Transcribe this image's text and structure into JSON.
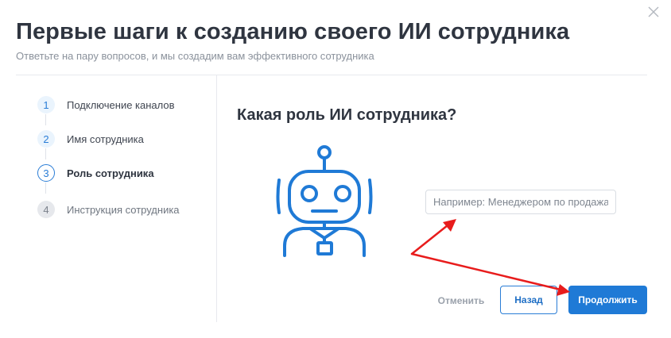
{
  "dialog": {
    "title": "Первые шаги к созданию своего ИИ сотрудника",
    "subtitle": "Ответьте на пару вопросов, и мы создадим вам эффективного сотрудника",
    "close_icon": "close-icon"
  },
  "steps": [
    {
      "num": "1",
      "label": "Подключение каналов",
      "state": "done"
    },
    {
      "num": "2",
      "label": "Имя сотрудника",
      "state": "done"
    },
    {
      "num": "3",
      "label": "Роль сотрудника",
      "state": "active"
    },
    {
      "num": "4",
      "label": "Инструкция сотрудника",
      "state": "todo"
    }
  ],
  "main": {
    "question": "Какая роль ИИ сотрудника?",
    "illustration_icon": "robot-icon",
    "role_input": {
      "value": "",
      "placeholder": "Например: Менеджером по продажам"
    }
  },
  "buttons": {
    "cancel": "Отменить",
    "back": "Назад",
    "continue": "Продолжить"
  },
  "colors": {
    "accent": "#1f7ad6",
    "annotation_arrow": "#e81c1c",
    "text_dark": "#2f3540",
    "text_muted": "#8b929c"
  }
}
